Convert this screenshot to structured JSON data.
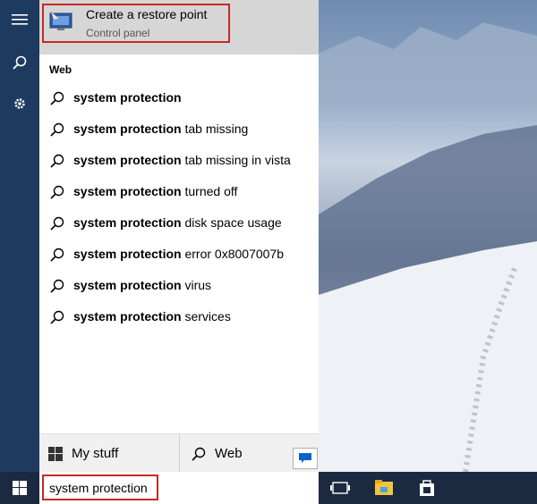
{
  "best_match": {
    "title": "Create a restore point",
    "subtitle": "Control panel"
  },
  "web_section": {
    "header": "Web",
    "results": [
      {
        "bold": "system protection",
        "rest": ""
      },
      {
        "bold": "system protection",
        "rest": " tab missing"
      },
      {
        "bold": "system protection",
        "rest": " tab missing in vista"
      },
      {
        "bold": "system protection",
        "rest": " turned off"
      },
      {
        "bold": "system protection",
        "rest": " disk space usage"
      },
      {
        "bold": "system protection",
        "rest": " error 0x8007007b"
      },
      {
        "bold": "system protection",
        "rest": " virus"
      },
      {
        "bold": "system protection",
        "rest": " services"
      }
    ]
  },
  "bottom_tabs": {
    "my_stuff": "My stuff",
    "web": "Web"
  },
  "search": {
    "value": "system protection"
  },
  "icons": {
    "hamburger": "hamburger-menu-icon",
    "search": "search-icon",
    "settings": "gear-icon",
    "windows": "windows-logo-icon",
    "task_view": "task-view-icon",
    "file_explorer": "file-explorer-icon",
    "store": "store-icon",
    "chat": "chat-bubble-icon"
  },
  "colors": {
    "rail": "#1f3a5f",
    "taskbar": "#1b2a40",
    "highlight_border": "#c62828",
    "best_match_bg": "#d6d6d6"
  }
}
